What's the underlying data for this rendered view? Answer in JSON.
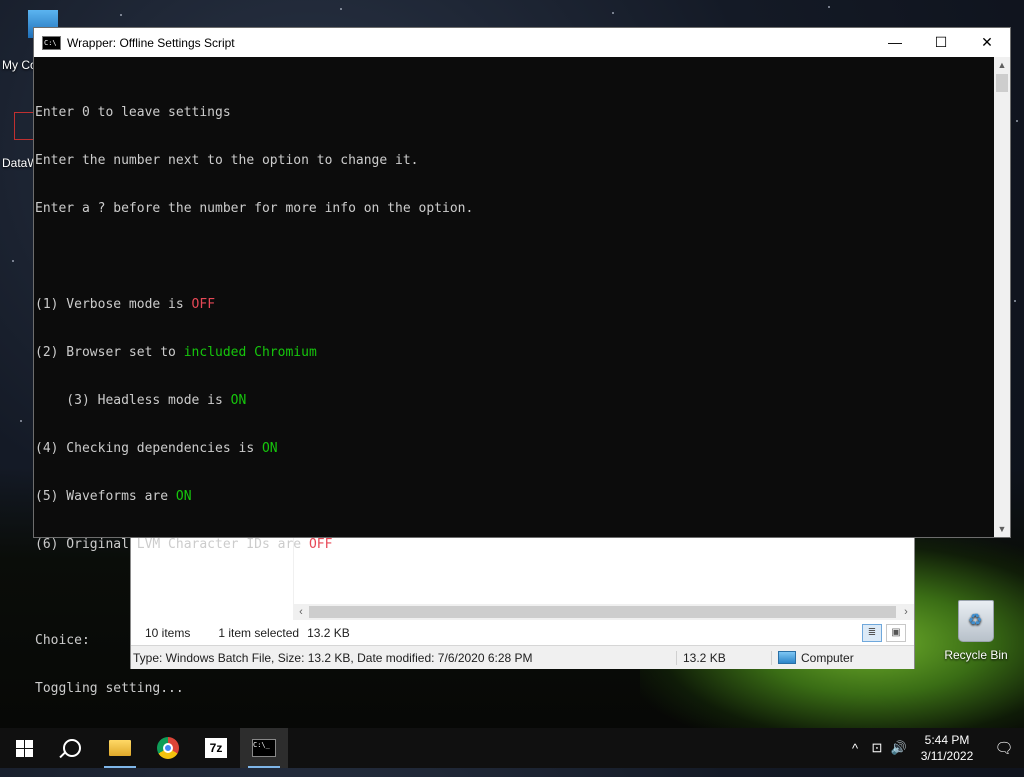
{
  "desktop": {
    "icons": {
      "my_computer": "My Co",
      "dataw": "DataW",
      "recycle_bin": "Recycle Bin"
    }
  },
  "console": {
    "title": "Wrapper: Offline Settings Script",
    "icon": "cmd-icon",
    "minimize": "—",
    "maximize": "☐",
    "close": "✕",
    "lines": {
      "l1": "Enter 0 to leave settings",
      "l2": "Enter the number next to the option to change it.",
      "l3": "Enter a ? before the number for more info on the option.",
      "o1_prefix": "(1) Verbose mode is ",
      "o1_value": "OFF",
      "o2_prefix": "(2) Browser set to ",
      "o2_value": "included Chromium",
      "o3_prefix": "    (3) Headless mode is ",
      "o3_value": "ON",
      "o4_prefix": "(4) Checking dependencies is ",
      "o4_value": "ON",
      "o5_prefix": "(5) Waveforms are ",
      "o5_value": "ON",
      "o6_prefix": "(6) Original LVM Character IDs are ",
      "o6_value": "OFF",
      "choice": "Choice:",
      "toggling": "Toggling setting..."
    },
    "colors": {
      "off": "#e74856",
      "on": "#16c60c",
      "text": "#cccccc"
    }
  },
  "explorer": {
    "status": {
      "items": "10 items",
      "selected": "1 item selected",
      "size": "13.2 KB"
    },
    "details": {
      "info": "Type: Windows Batch File, Size: 13.2 KB, Date modified: 7/6/2020 6:28 PM",
      "size": "13.2 KB",
      "location": "Computer"
    },
    "scroll": {
      "left": "‹",
      "right": "›"
    }
  },
  "taskbar": {
    "apps": [
      "start-button",
      "search-button",
      "file-explorer",
      "chrome",
      "7-zip",
      "command-prompt"
    ],
    "sevenzip_label": "7z",
    "tray": {
      "chevron": "^",
      "network": "⊡",
      "volume": "🔊",
      "time": "5:44 PM",
      "date": "3/11/2022",
      "notifications": "🗨"
    }
  }
}
